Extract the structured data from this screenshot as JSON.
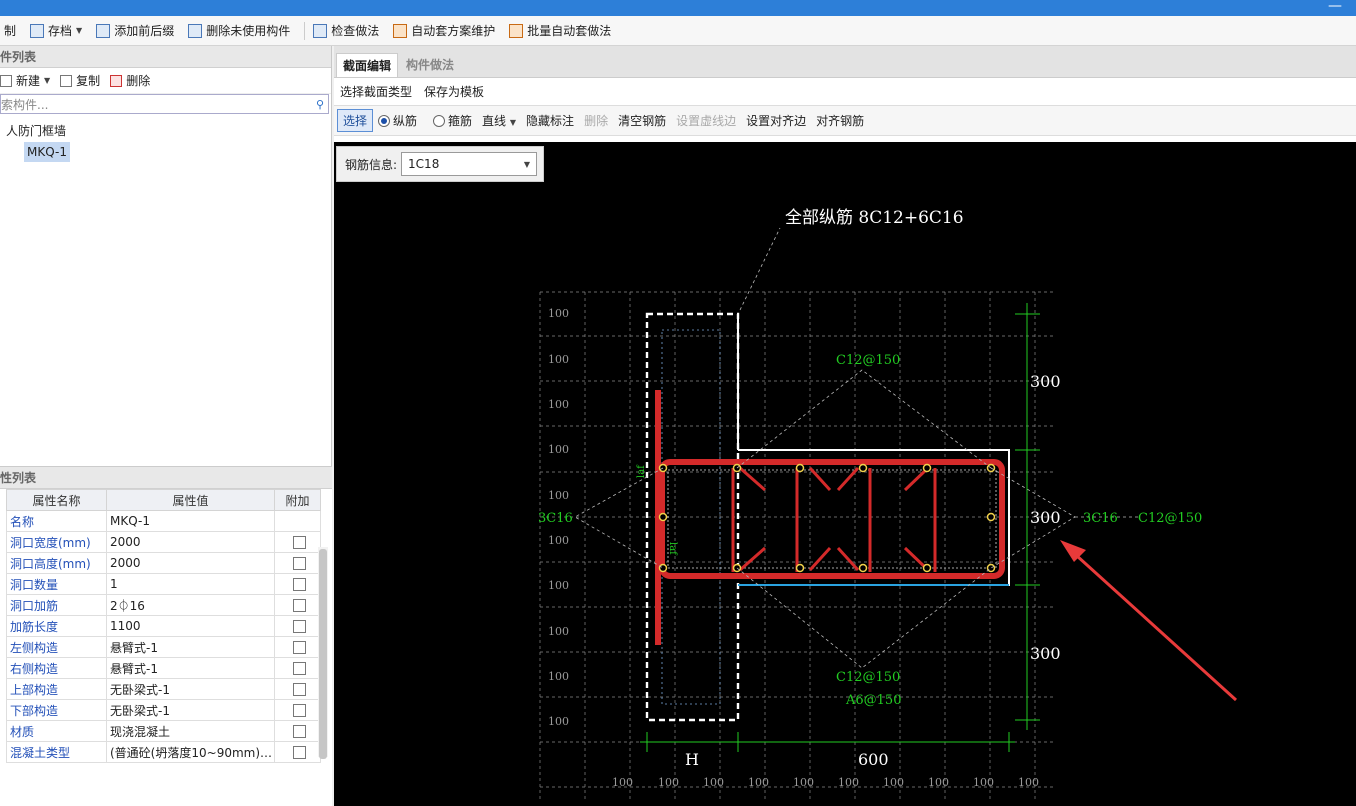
{
  "toolbar": {
    "items": [
      "制",
      "存档",
      "添加前后缀",
      "删除未使用构件",
      "检查做法",
      "自动套方案维护",
      "批量自动套做法"
    ]
  },
  "component_list": {
    "title": "件列表",
    "new_label": "新建",
    "copy_label": "复制",
    "delete_label": "删除",
    "search_placeholder": "索构件...",
    "tree_root": "人防门框墙",
    "tree_child": "MKQ-1"
  },
  "property_list": {
    "title": "性列表",
    "col_name": "属性名称",
    "col_value": "属性值",
    "col_extra": "附加",
    "rows": [
      {
        "name": "名称",
        "value": "MKQ-1",
        "checkbox": false
      },
      {
        "name": "洞口宽度(mm)",
        "value": "2000",
        "checkbox": true
      },
      {
        "name": "洞口高度(mm)",
        "value": "2000",
        "checkbox": true
      },
      {
        "name": "洞口数量",
        "value": "1",
        "checkbox": true
      },
      {
        "name": "洞口加筋",
        "value": "2⏀16",
        "checkbox": true
      },
      {
        "name": "加筋长度",
        "value": "1100",
        "checkbox": true
      },
      {
        "name": "左侧构造",
        "value": "悬臂式-1",
        "checkbox": true
      },
      {
        "name": "右侧构造",
        "value": "悬臂式-1",
        "checkbox": true
      },
      {
        "name": "上部构造",
        "value": "无卧梁式-1",
        "checkbox": true
      },
      {
        "name": "下部构造",
        "value": "无卧梁式-1",
        "checkbox": true
      },
      {
        "name": "材质",
        "value": "现浇混凝土",
        "checkbox": true
      },
      {
        "name": "混凝土类型",
        "value": "(普通砼(坍落度10~90mm) ...",
        "checkbox": true
      }
    ]
  },
  "editor": {
    "tabs": [
      "截面编辑",
      "构件做法"
    ],
    "bar1": [
      "选择截面类型",
      "保存为模板"
    ],
    "bar2": {
      "select": "选择",
      "longitudinal": "纵筋",
      "stirrup": "箍筋",
      "line": "直线",
      "hide_mark": "隐藏标注",
      "delete": "删除",
      "clear": "清空钢筋",
      "set_dashed": "设置虚线边",
      "set_align": "设置对齐边",
      "align_rebar": "对齐钢筋"
    },
    "rebar_info_label": "钢筋信息:",
    "rebar_info_value": "1C18"
  },
  "drawing": {
    "all_rebar": "全部纵筋 8C12+6C16",
    "stirrup_top": "C12@150",
    "stirrup_bottom": "C12@150",
    "tie": "A6@150",
    "left_rebar": "3C16",
    "right_rebar": "3C16",
    "right_stirrup": "C12@150",
    "dim_300_a": "300",
    "dim_300_b": "300",
    "dim_300_c": "300",
    "dim_H": "H",
    "dim_600": "600",
    "grid_label": "100",
    "laf": "laf",
    "colors": {
      "rebar": "#d42a2a",
      "grid": "#8a8a8a",
      "green": "#22cc22",
      "annot": "#ffffff",
      "arrow": "#e83a3a"
    }
  }
}
